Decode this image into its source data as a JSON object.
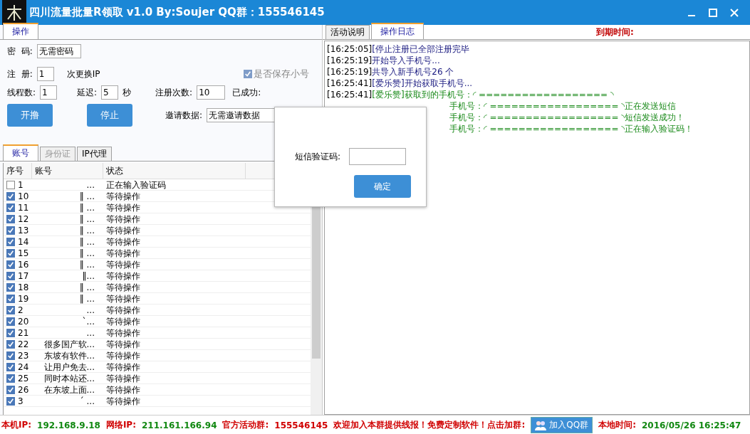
{
  "window": {
    "title": "四川流量批量R领取 v1.0 By:Soujer QQ群：155546145"
  },
  "left_tabs": [
    {
      "label": "操作",
      "selected": true
    }
  ],
  "form": {
    "password_label": "密  码:",
    "password_value": "无需密码",
    "register_label": "注  册:",
    "register_value": "1",
    "register_suffix": "次更换IP",
    "save_checkbox": {
      "label": "是否保存小号",
      "checked": true,
      "disabled": true
    },
    "threads_label": "线程数:",
    "threads_value": "1",
    "delay_label": "延迟:",
    "delay_value": "5",
    "delay_unit": "秒",
    "count_label": "注册次数:",
    "count_value": "10",
    "success_label": "已成功:",
    "invite_label": "邀请数据:",
    "invite_value": "无需邀请数据"
  },
  "buttons": [
    {
      "label": "开撸"
    },
    {
      "label": "停止"
    }
  ],
  "list_tabs": [
    {
      "label": "账号",
      "selected": true,
      "disabled": false
    },
    {
      "label": "身份证",
      "selected": false,
      "disabled": true
    },
    {
      "label": "IP代理",
      "selected": false,
      "disabled": false
    }
  ],
  "table": {
    "columns": [
      "序号",
      "账号",
      "状态"
    ],
    "rows": [
      {
        "no": "1",
        "account": "...",
        "status": "正在输入验证码",
        "checked": false
      },
      {
        "no": "10",
        "account": "‖ ...",
        "status": "等待操作",
        "checked": true
      },
      {
        "no": "11",
        "account": "‖ ...",
        "status": "等待操作",
        "checked": true
      },
      {
        "no": "12",
        "account": "‖ ...",
        "status": "等待操作",
        "checked": true
      },
      {
        "no": "13",
        "account": "‖ ...",
        "status": "等待操作",
        "checked": true
      },
      {
        "no": "14",
        "account": "‖ ...",
        "status": "等待操作",
        "checked": true
      },
      {
        "no": "15",
        "account": "‖ ...",
        "status": "等待操作",
        "checked": true
      },
      {
        "no": "16",
        "account": "‖ ...",
        "status": "等待操作",
        "checked": true
      },
      {
        "no": "17",
        "account": "‖...",
        "status": "等待操作",
        "checked": true
      },
      {
        "no": "18",
        "account": "‖ ...",
        "status": "等待操作",
        "checked": true
      },
      {
        "no": "19",
        "account": "‖ ...",
        "status": "等待操作",
        "checked": true
      },
      {
        "no": "2",
        "account": "...",
        "status": "等待操作",
        "checked": true
      },
      {
        "no": "20",
        "account": "ˋ...",
        "status": "等待操作",
        "checked": true
      },
      {
        "no": "21",
        "account": "...",
        "status": "等待操作",
        "checked": true
      },
      {
        "no": "22",
        "account": "很多国产软...",
        "status": "等待操作",
        "checked": true
      },
      {
        "no": "23",
        "account": "东坡有软件...",
        "status": "等待操作",
        "checked": true
      },
      {
        "no": "24",
        "account": "让用户免去...",
        "status": "等待操作",
        "checked": true
      },
      {
        "no": "25",
        "account": "同时本站还...",
        "status": "等待操作",
        "checked": true
      },
      {
        "no": "26",
        "account": "在东坡上面...",
        "status": "等待操作",
        "checked": true
      },
      {
        "no": "3",
        "account": "ˊ ...",
        "status": "等待操作",
        "checked": true
      }
    ]
  },
  "right_tabs": [
    {
      "label": "活动说明",
      "selected": false
    },
    {
      "label": "操作日志",
      "selected": true
    }
  ],
  "expiry_label": "到期时间:",
  "log": [
    {
      "time": "[16:25:05]",
      "text": "[停止注册已全部注册完毕",
      "kind": "info"
    },
    {
      "time": "[16:25:19]",
      "text": "开始导入手机号...",
      "kind": "info"
    },
    {
      "time": "[16:25:19]",
      "text": "共导入新手机号26 个",
      "kind": "info"
    },
    {
      "time": "[16:25:41]",
      "text": "[爱乐赞]开始获取手机号...",
      "kind": "info"
    },
    {
      "time": "[16:25:41]",
      "text": "[爱乐赞]获取到的手机号：◜ ================== ◝",
      "kind": "success"
    },
    {
      "text": "手机号：◜ ================== ◝正在发送短信",
      "kind": "cut"
    },
    {
      "text": "手机号：◜ ================== ◝短信发送成功！",
      "kind": "cut"
    },
    {
      "text": "手机号：◜ ================== ◝正在输入验证码！",
      "kind": "cut"
    }
  ],
  "dialog": {
    "label": "短信验证码:",
    "button": "确定"
  },
  "status_bar": [
    {
      "text": "本机IP:",
      "kind": "label"
    },
    {
      "text": "192.168.9.18",
      "kind": "value"
    },
    {
      "text": "网络IP:",
      "kind": "label"
    },
    {
      "text": "211.161.166.94",
      "kind": "value"
    },
    {
      "text": "官方活动群:",
      "kind": "label"
    },
    {
      "text": "155546145",
      "kind": "label"
    },
    {
      "text": "欢迎加入本群提供线报！免费定制软件！点击加群:",
      "kind": "label"
    },
    {
      "text": "加入QQ群",
      "kind": "button"
    },
    {
      "text": "本地时间:",
      "kind": "label"
    },
    {
      "text": "2016/05/26 16:25:47",
      "kind": "value"
    }
  ]
}
